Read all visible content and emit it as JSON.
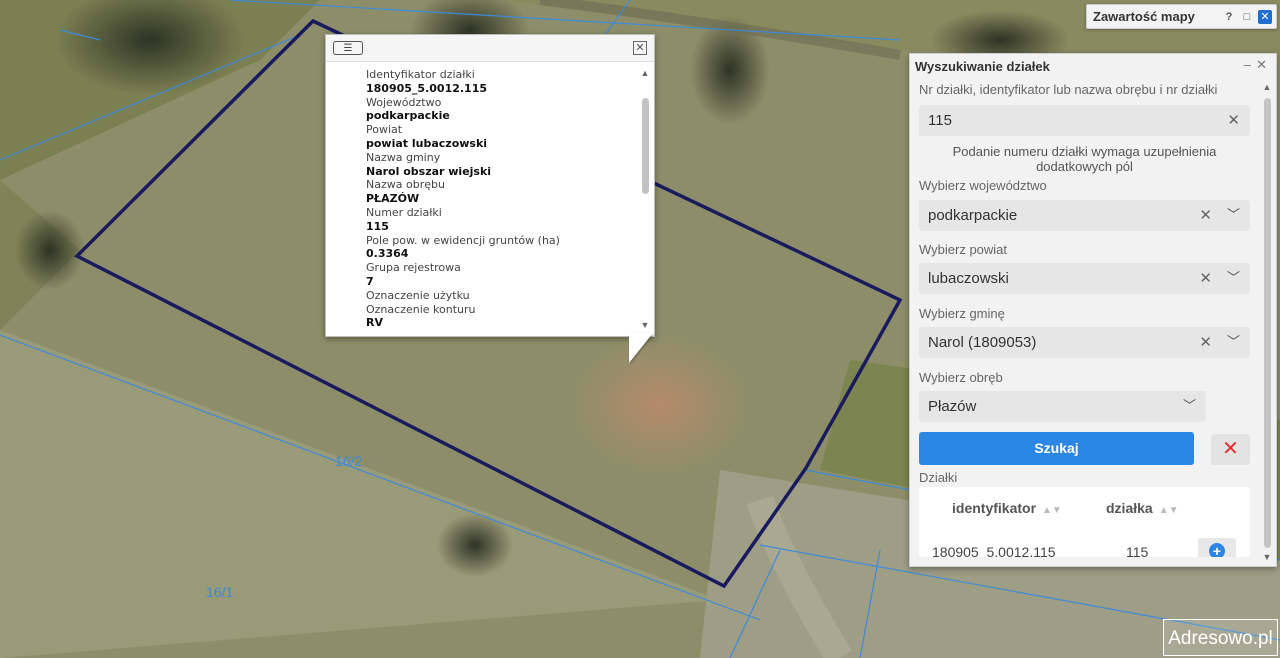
{
  "map": {
    "parcel_labels": [
      "16/2",
      "16/1"
    ]
  },
  "content_widget": {
    "title": "Zawartość mapy",
    "help_icon": "?",
    "max_icon": "□",
    "close_icon": "✕"
  },
  "popup": {
    "fields": [
      {
        "label": "Identyfikator działki",
        "value": "180905_5.0012.115"
      },
      {
        "label": "Województwo",
        "value": "podkarpackie"
      },
      {
        "label": "Powiat",
        "value": "powiat lubaczowski"
      },
      {
        "label": "Nazwa gminy",
        "value": "Narol obszar wiejski"
      },
      {
        "label": "Nazwa obrębu",
        "value": "PŁAZÓW"
      },
      {
        "label": "Numer działki",
        "value": "115"
      },
      {
        "label": "Pole pow. w ewidencji gruntów (ha)",
        "value": "0.3364"
      },
      {
        "label": "Grupa rejestrowa",
        "value": "7"
      },
      {
        "label": "Oznaczenie użytku",
        "value": ""
      },
      {
        "label": "Oznaczenie konturu",
        "value": "RV"
      }
    ],
    "close_icon": "✕"
  },
  "panel": {
    "title": "Wyszukiwanie działek",
    "query_label": "Nr działki, identyfikator lub nazwa obrębu i nr działki",
    "query_value": "115",
    "notice": "Podanie numeru działki wymaga uzupełnienia dodatkowych pól",
    "voivodeship_label": "Wybierz województwo",
    "voivodeship_value": "podkarpackie",
    "county_label": "Wybierz powiat",
    "county_value": "lubaczowski",
    "commune_label": "Wybierz gminę",
    "commune_value": "Narol (1809053)",
    "precinct_label": "Wybierz obręb",
    "precinct_value": "Płazów",
    "search_button": "Szukaj",
    "clear_button": "✕",
    "results_label": "Działki",
    "columns": [
      "identyfikator",
      "działka"
    ],
    "rows": [
      [
        "180905_5.0012.115",
        "115"
      ]
    ]
  },
  "brand": "Adresowo.pl",
  "colors": {
    "parcel_outline": "#1a1a5e",
    "cadastral_lines": "#3d8ad6",
    "primary_button": "#2c86e6",
    "clear_button_icon": "#e03030"
  }
}
